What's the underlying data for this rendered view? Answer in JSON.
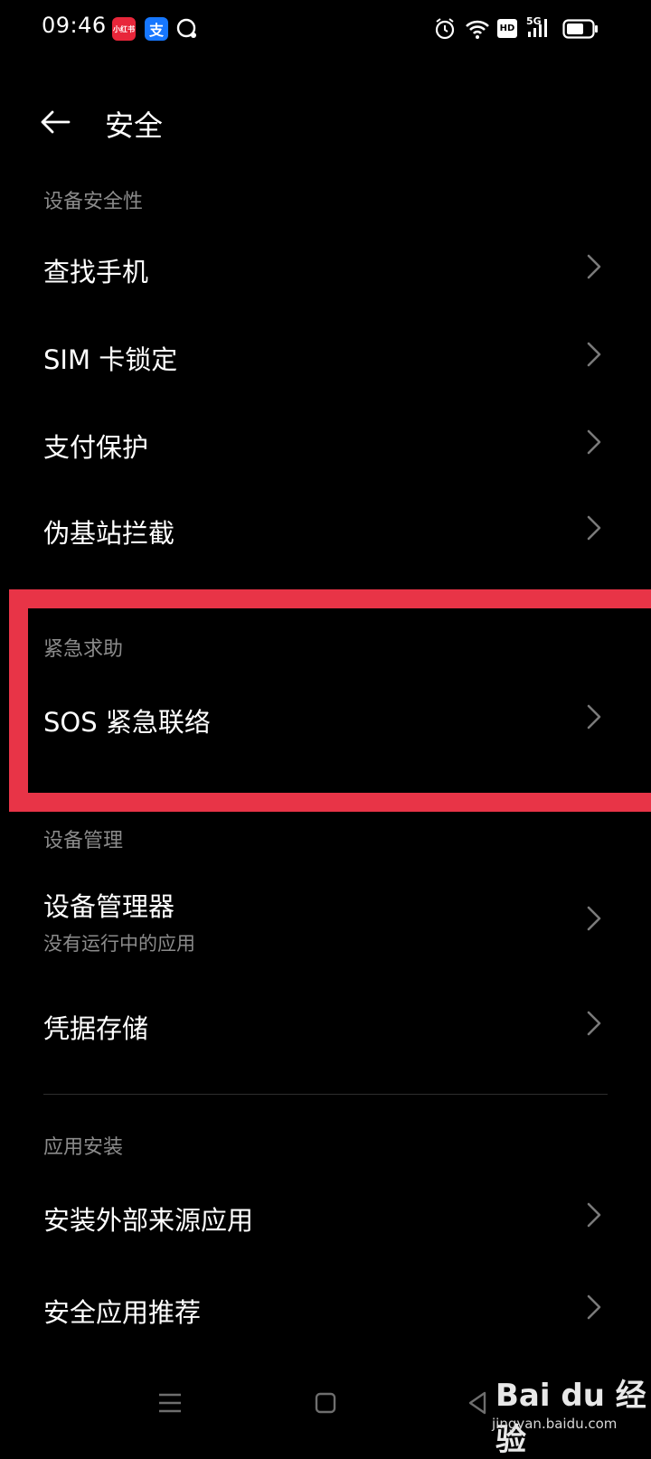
{
  "status_bar": {
    "time": "09:46",
    "app_badges": [
      "小红书",
      "支"
    ],
    "icons": [
      "alarm-icon",
      "wifi-icon",
      "hd-icon",
      "5g-signal-icon",
      "battery-icon"
    ],
    "hd_label": "HD",
    "network_label": "5G"
  },
  "header": {
    "title": "安全"
  },
  "sections": {
    "device_security": {
      "title": "设备安全性",
      "items": [
        "查找手机",
        "SIM 卡锁定",
        "支付保护",
        "伪基站拦截"
      ]
    },
    "emergency": {
      "title": "紧急求助",
      "items": [
        "SOS 紧急联络"
      ]
    },
    "device_management": {
      "title": "设备管理",
      "item0_label": "设备管理器",
      "item0_sub": "没有运行中的应用",
      "item1_label": "凭据存储"
    },
    "app_install": {
      "title": "应用安装",
      "items": [
        "安装外部来源应用",
        "安全应用推荐"
      ]
    }
  },
  "watermark": {
    "logo": "Bai du 经验",
    "url": "jingyan.baidu.com"
  },
  "colors": {
    "background": "#000000",
    "highlight": "#e83447",
    "section_title": "#8b8b8b"
  }
}
